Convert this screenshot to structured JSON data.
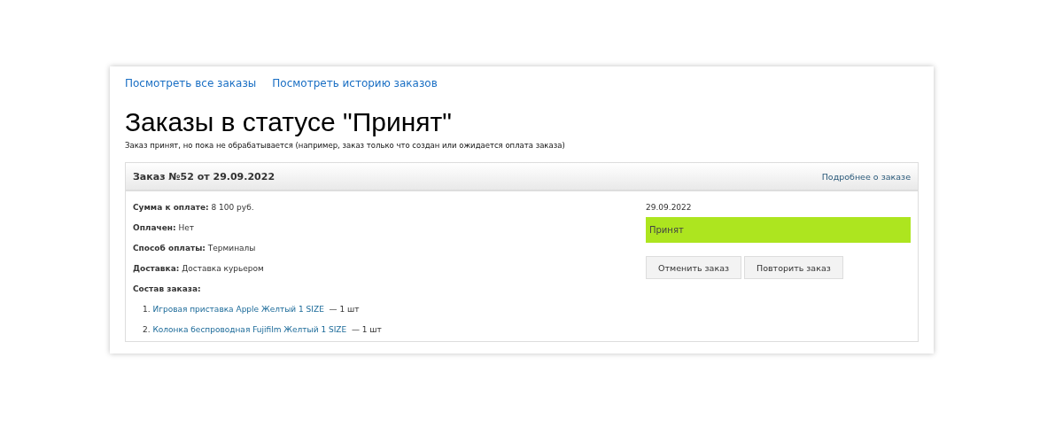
{
  "nav_links": [
    "Посмотреть все заказы",
    "Посмотреть историю заказов"
  ],
  "heading": "Заказы в статусе \"Принят\"",
  "description": "Заказ принят, но пока не обрабатывается (например, заказ только что создан или ожидается оплата заказа)",
  "order": {
    "title": "Заказ №52 от 29.09.2022",
    "details_link": "Подробнее о заказе",
    "fields": [
      {
        "label": "Сумма к оплате:",
        "value": "8 100 руб."
      },
      {
        "label": "Оплачен:",
        "value": "Нет"
      },
      {
        "label": "Способ оплаты:",
        "value": "Терминалы"
      },
      {
        "label": "Доставка:",
        "value": "Доставка курьером"
      }
    ],
    "items_label": "Состав заказа:",
    "items": [
      {
        "number": "1.",
        "name": "Игровая приставка Apple Желтый 1 SIZE",
        "quantity": "— 1 шт"
      },
      {
        "number": "2.",
        "name": "Колонка беспроводная Fujifilm Желтый 1 SIZE",
        "quantity": "— 1 шт"
      }
    ],
    "date": "29.09.2022",
    "status": {
      "label": "Принят",
      "color": "#ade51f"
    },
    "buttons": [
      "Отменить заказ",
      "Повторить заказ"
    ]
  }
}
